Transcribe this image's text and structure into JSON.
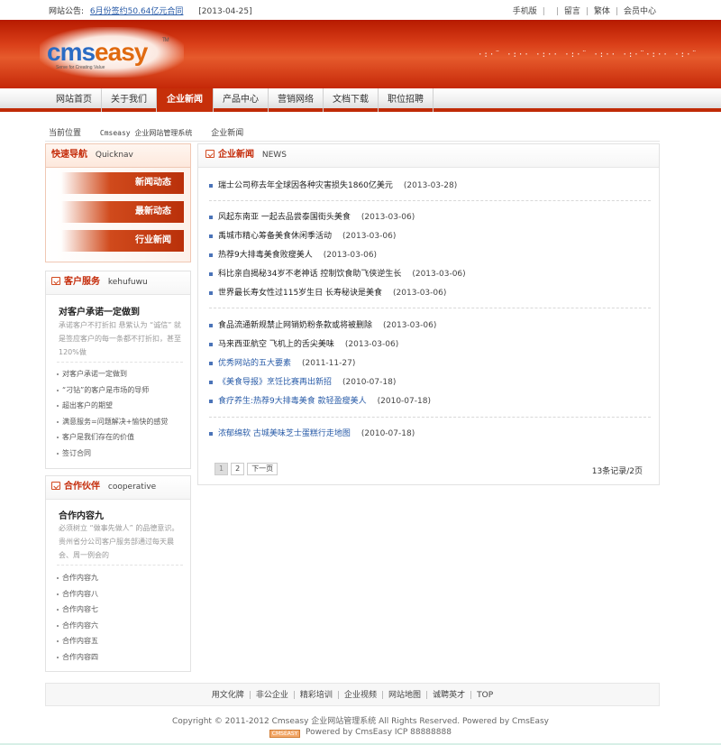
{
  "topbar": {
    "notice_label": "网站公告:",
    "notice_link": "6月份签约50.64亿元合同",
    "notice_date": "[2013-04-25]",
    "links": [
      "手机版",
      "留言",
      "繁体",
      "会员中心"
    ]
  },
  "header": {
    "logo_part1": "cms",
    "logo_part2": "easy",
    "logo_tm": "TM",
    "logo_tagline": "Serve for Creating Value",
    "slogan": "·:·¨ ·:·· ·:·· ·:·¨ ·:·· ·:·¨·:·· ·:·¨"
  },
  "nav": {
    "items": [
      "网站首页",
      "关于我们",
      "企业新闻",
      "产品中心",
      "营销网络",
      "文档下载",
      "职位招聘"
    ],
    "active": "企业新闻"
  },
  "breadcrumb": {
    "label": "当前位置",
    "site": "Cmseasy 企业网站管理系统",
    "current": "企业新闻"
  },
  "quicknav": {
    "title": "快速导航",
    "title_en": "Quicknav",
    "buttons": [
      "新闻动态",
      "最新动态",
      "行业新闻"
    ]
  },
  "service": {
    "title": "客户服务",
    "title_en": "kehufuwu",
    "subtitle": "对客户承诺一定做到",
    "desc": "承诺客户不打折扣 悬紫认为 “诚信” 就是签应客户的每一条都不打折扣，甚至120%做",
    "items": [
      "对客户承诺一定做到",
      "“刁钻”的客户是市场的导师",
      "超出客户的期望",
      "满意服务=问题解决+愉快的感觉",
      "客户是我们存在的价值",
      "签订合同"
    ]
  },
  "partner": {
    "title": "合作伙伴",
    "title_en": "cooperative",
    "subtitle": "合作内容九",
    "desc": "必须树立 “做事先做人” 的品德意识。贵州省分公司客户服务部通过每天晨会、周一例会的",
    "items": [
      "合作内容九",
      "合作内容八",
      "合作内容七",
      "合作内容六",
      "合作内容五",
      "合作内容四"
    ]
  },
  "news": {
    "title": "企业新闻",
    "title_en": "NEWS",
    "items": [
      {
        "title": "瑞士公司称去年全球因各种灾害损失1860亿美元",
        "date": "(2013-03-28)"
      },
      {
        "title": "风起东南亚 一起去品尝泰国街头美食",
        "date": "(2013-03-06)"
      },
      {
        "title": "禹城市精心筹备美食休闲季活动",
        "date": "(2013-03-06)"
      },
      {
        "title": "热荐9大排毒美食败瘦美人",
        "date": "(2013-03-06)"
      },
      {
        "title": "科比亲自揭秘34岁不老神话 控制饮食助飞侠逆生长",
        "date": "(2013-03-06)"
      },
      {
        "title": "世界最长寿女性过115岁生日 长寿秘诀是美食",
        "date": "(2013-03-06)"
      },
      {
        "title": "食品流通新规禁止网销奶粉条款或将被删除",
        "date": "(2013-03-06)"
      },
      {
        "title": "马来西亚航空 飞机上的舌尖美味",
        "date": "(2013-03-06)"
      },
      {
        "title": "优秀网站的五大要素",
        "date": "(2011-11-27)"
      },
      {
        "title": "《美食导报》烹饪比赛再出新招",
        "date": "(2010-07-18)"
      },
      {
        "title": "食疗养生:热荐9大排毒美食 款轻盈瘦美人",
        "date": "(2010-07-18)"
      },
      {
        "title": "浓郁绵软 古城美味芝士蛋糕行走地图",
        "date": "(2010-07-18)"
      }
    ],
    "pager": [
      "1",
      "2",
      "下一页"
    ],
    "count": "13条记录/2页"
  },
  "footer": {
    "links": [
      "用文化牌",
      "非公企业",
      "精彩培训",
      "企业视频",
      "网站地图",
      "诚聘英才",
      "TOP"
    ],
    "copyright": "Copyright © 2011-2012 Cmseasy 企业网站管理系统 All Rights Reserved.  Powered by CmsEasy",
    "badge": "CMSEASY",
    "powered": "Powered by CmsEasy  ICP 88888888"
  }
}
